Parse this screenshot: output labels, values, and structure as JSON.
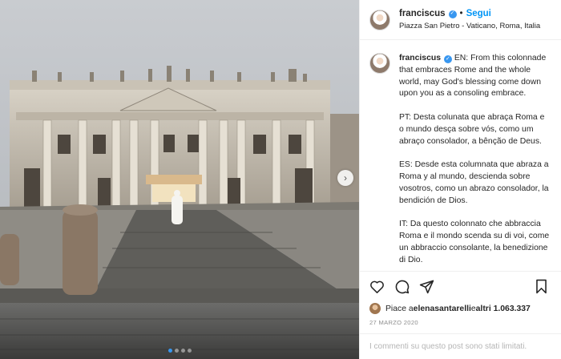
{
  "header": {
    "username": "franciscus",
    "follow_label": "Segui",
    "separator": "•",
    "location": "Piazza San Pietro - Vaticano, Roma, Italia"
  },
  "caption": {
    "username": "franciscus",
    "text": "EN: From this colonnade that embraces Rome and the whole world, may God's blessing come down upon you as a consoling embrace.\n\nPT: Desta colunata que abraça Roma e o mundo desça sobre vós, como um abraço consolador, a bênção de Deus.\n\nES: Desde esta columnata que abraza a Roma y al mundo, descienda sobre vosotros, como un abrazo consolador, la bendición de Dios.\n\nIT: Da questo colonnato che abbraccia Roma e il mondo scenda su di voi, come un abbraccio consolante, la benedizione di Dio.\n\nFR: Que, de cette colonnade qui"
  },
  "likes": {
    "prefix": "Piace a ",
    "user": "elenasantarelli",
    "mid": " e ",
    "others": "altri 1.063.337"
  },
  "date": "27 MARZO 2020",
  "comments_notice": "I commenti su questo post sono stati limitati.",
  "carousel": {
    "total": 4,
    "active_index": 0
  },
  "icons": [
    "heart-icon",
    "comment-icon",
    "share-icon",
    "bookmark-icon",
    "verified-icon",
    "more-icon",
    "chevron-right-icon"
  ],
  "colors": {
    "accent": "#0095f6",
    "verified": "#3897f0",
    "border": "#efefef",
    "muted": "#8e8e8e"
  }
}
